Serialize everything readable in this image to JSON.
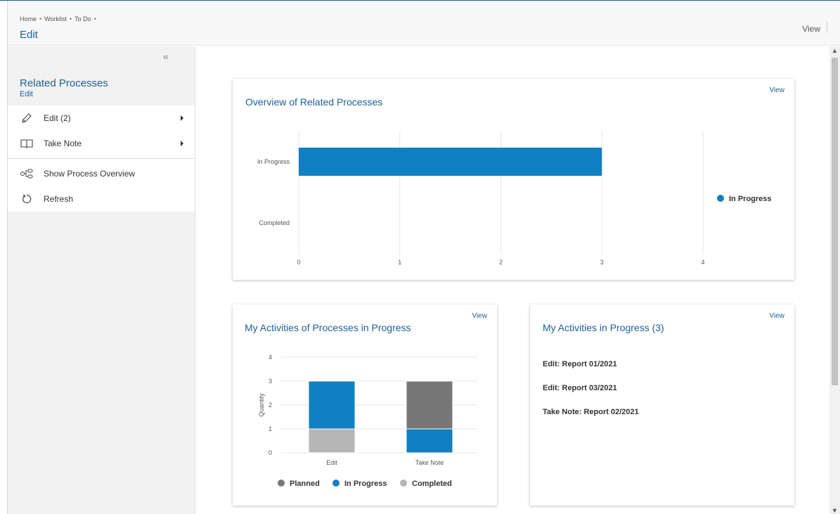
{
  "header": {
    "breadcrumb": [
      "Home",
      "Worklist",
      "To Do"
    ],
    "title": "Edit",
    "view_label": "View"
  },
  "sidebar": {
    "collapse_icon": "double-chevron-left-icon",
    "title": "Related Processes",
    "subtitle": "Edit",
    "items": [
      {
        "label": "Edit (2)",
        "icon": "pencil-icon",
        "has_submenu": true
      },
      {
        "label": "Take Note",
        "icon": "book-icon",
        "has_submenu": true
      },
      {
        "label": "Show Process Overview",
        "icon": "process-graph-icon",
        "has_submenu": false
      },
      {
        "label": "Refresh",
        "icon": "refresh-icon",
        "has_submenu": false
      }
    ]
  },
  "colors": {
    "accent": "#1e5f96",
    "in_progress": "#0f80c1",
    "planned": "#777777",
    "completed": "#b5b5b5"
  },
  "cards": {
    "overview": {
      "title": "Overview of Related Processes",
      "view_label": "View"
    },
    "activities_chart": {
      "title": "My Activities of Processes in Progress",
      "view_label": "View"
    },
    "activities_list": {
      "title": "My Activities in Progress (3)",
      "view_label": "View",
      "items": [
        "Edit: Report 01/2021",
        "Edit: Report 03/2021",
        "Take Note: Report 02/2021"
      ]
    }
  },
  "chart_data": [
    {
      "type": "bar",
      "orientation": "horizontal",
      "categories": [
        "In Progress",
        "Completed"
      ],
      "series": [
        {
          "name": "In Progress",
          "values": [
            3,
            0
          ]
        }
      ],
      "xlim": [
        0,
        4
      ],
      "xticks": [
        "0",
        "1",
        "2",
        "3",
        "4"
      ],
      "legend": [
        "In Progress"
      ],
      "legend_position": "right",
      "grid": true
    },
    {
      "type": "bar",
      "stacked": true,
      "categories": [
        "Edit",
        "Take Note"
      ],
      "series": [
        {
          "name": "Completed",
          "values": [
            1,
            0
          ]
        },
        {
          "name": "In Progress",
          "values": [
            2,
            1
          ]
        },
        {
          "name": "Planned",
          "values": [
            0,
            2
          ]
        }
      ],
      "ylabel": "Quantity",
      "ylim": [
        0,
        4
      ],
      "yticks": [
        "0",
        "1",
        "2",
        "3",
        "4"
      ],
      "legend": [
        "Planned",
        "In Progress",
        "Completed"
      ],
      "legend_position": "bottom",
      "grid": true
    }
  ]
}
